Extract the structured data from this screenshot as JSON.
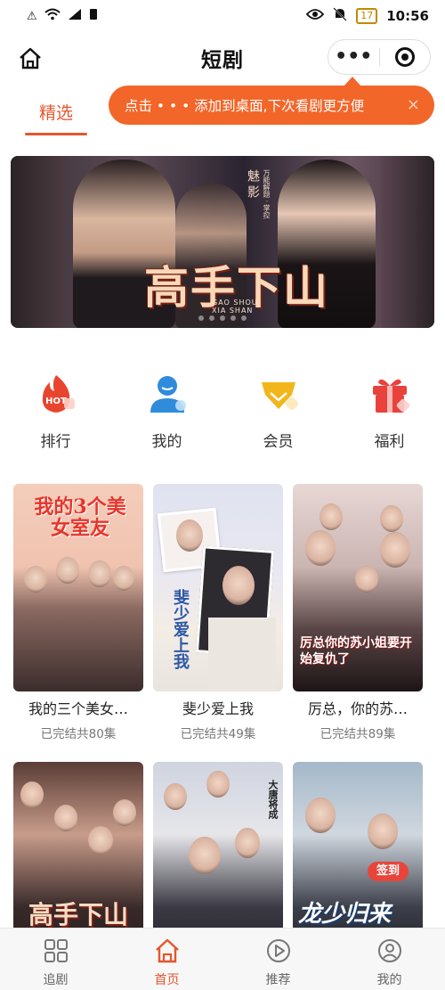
{
  "status_bar": {
    "battery": "17",
    "time": "10:56"
  },
  "header": {
    "title": "短剧",
    "more_label": "•••"
  },
  "tabs": [
    {
      "label": "精选",
      "active": true
    }
  ],
  "tooltip": {
    "text": "点击 • • • 添加到桌面,下次看剧更方便",
    "close_label": "×"
  },
  "banner": {
    "title": "高手下山",
    "subtitle_line1": "GAO SHOU",
    "subtitle_line2": "XIA SHAN",
    "side_text": "魅影",
    "side_small": "万能解题 · 掌控",
    "dots": 5
  },
  "quick_menu": [
    {
      "label": "排行",
      "icon": "hot-flame-icon",
      "badge": "HOT",
      "color": "#e8452f"
    },
    {
      "label": "我的",
      "icon": "user-icon",
      "color": "#2f8bdc"
    },
    {
      "label": "会员",
      "icon": "diamond-icon",
      "color": "#f2b51c"
    },
    {
      "label": "福利",
      "icon": "gift-icon",
      "color": "#e9413c"
    }
  ],
  "dramas": [
    {
      "title": "我的三个美女…",
      "status": "已完结共80集",
      "poster_text": "我的3个美女室友"
    },
    {
      "title": "斐少爱上我",
      "status": "已完结共49集",
      "poster_text": "斐少爱上我"
    },
    {
      "title": "厉总，你的苏…",
      "status": "已完结共89集",
      "poster_text": "厉总你的苏小姐要开始复仇了"
    },
    {
      "title": "",
      "status": "",
      "poster_text": "高手下山"
    },
    {
      "title": "",
      "status": "",
      "poster_text": "大唐将成"
    },
    {
      "title": "",
      "status": "",
      "poster_text": "龙少归来",
      "badge": "签到"
    }
  ],
  "bottom_nav": [
    {
      "label": "追剧",
      "icon": "grid-icon",
      "active": false
    },
    {
      "label": "首页",
      "icon": "home-icon",
      "active": true
    },
    {
      "label": "推荐",
      "icon": "play-icon",
      "active": false
    },
    {
      "label": "我的",
      "icon": "profile-icon",
      "active": false
    }
  ],
  "colors": {
    "accent": "#e4572e",
    "tooltip_bg": "#f2662a"
  }
}
